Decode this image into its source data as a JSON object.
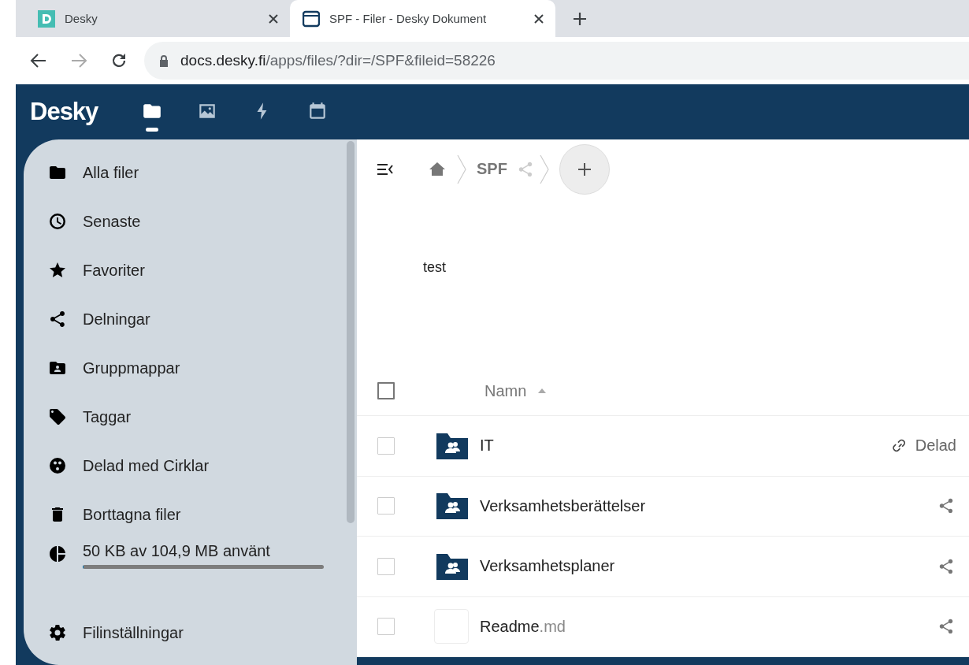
{
  "browser": {
    "tabs": [
      {
        "title": "Desky",
        "kind": "desky",
        "selected": false
      },
      {
        "title": "SPF - Filer - Desky Dokument",
        "kind": "folder",
        "selected": true
      }
    ],
    "url": {
      "host": "docs.desky.fi",
      "path": "/apps/files/?dir=/SPF&fileid=58226"
    }
  },
  "app": {
    "logo": "Desky",
    "nav": [
      {
        "kind": "files",
        "selected": true
      },
      {
        "kind": "photos",
        "selected": false
      },
      {
        "kind": "activity",
        "selected": false
      },
      {
        "kind": "calendar",
        "selected": false
      }
    ]
  },
  "sidebar": {
    "items": [
      {
        "label": "Alla filer",
        "kind": "folder"
      },
      {
        "label": "Senaste",
        "kind": "clock"
      },
      {
        "label": "Favoriter",
        "kind": "star"
      },
      {
        "label": "Delningar",
        "kind": "share"
      },
      {
        "label": "Gruppmappar",
        "kind": "group-folder"
      },
      {
        "label": "Taggar",
        "kind": "tag"
      },
      {
        "label": "Delad med Cirklar",
        "kind": "circles"
      },
      {
        "label": "Borttagna filer",
        "kind": "trash"
      }
    ],
    "quota": {
      "text": "50 KB av 104,9 MB använt",
      "level": 0.0005
    },
    "settings": "Filinställningar"
  },
  "breadcrumb": {
    "items": [
      "SPF"
    ]
  },
  "description": "test",
  "table": {
    "header_checked": false,
    "columns": [
      {
        "label": "Namn",
        "sort_ascending": true
      }
    ],
    "rows": [
      {
        "name": "IT",
        "kind": "group-folder",
        "link_shared": true,
        "share_label": "Delad",
        "checked": false
      },
      {
        "name": "Verksamhetsberättelser",
        "kind": "group-folder",
        "link_shared": false,
        "checked": false
      },
      {
        "name": "Verksamhetsplaner",
        "kind": "group-folder",
        "link_shared": false,
        "checked": false
      },
      {
        "name": "Readme",
        "extension": ".md",
        "kind": "file",
        "link_shared": false,
        "checked": false
      }
    ]
  }
}
